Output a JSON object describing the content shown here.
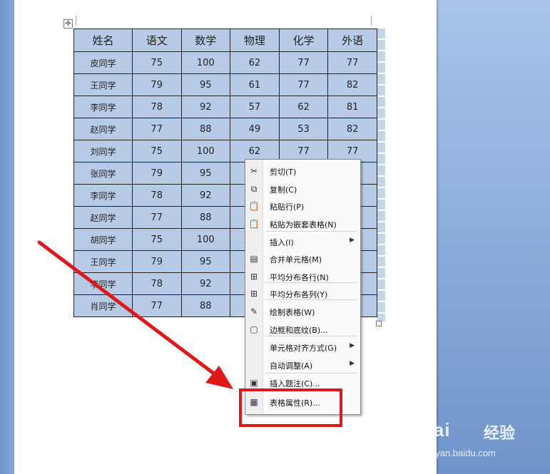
{
  "table": {
    "headers": [
      "姓名",
      "语文",
      "数学",
      "物理",
      "化学",
      "外语"
    ],
    "rows": [
      [
        "皮同学",
        "75",
        "100",
        "62",
        "77",
        "77"
      ],
      [
        "王同学",
        "79",
        "95",
        "61",
        "77",
        "82"
      ],
      [
        "李同学",
        "78",
        "92",
        "57",
        "62",
        "81"
      ],
      [
        "赵同学",
        "77",
        "88",
        "49",
        "53",
        "82"
      ],
      [
        "刘同学",
        "75",
        "100",
        "62",
        "77",
        "77"
      ],
      [
        "张同学",
        "79",
        "95",
        "",
        "",
        ""
      ],
      [
        "李同学",
        "78",
        "92",
        "",
        "",
        ""
      ],
      [
        "赵同学",
        "77",
        "88",
        "",
        "",
        ""
      ],
      [
        "胡同学",
        "75",
        "100",
        "",
        "",
        ""
      ],
      [
        "王同学",
        "79",
        "95",
        "",
        "",
        ""
      ],
      [
        "李同学",
        "78",
        "92",
        "",
        "",
        ""
      ],
      [
        "肖同学",
        "77",
        "88",
        "",
        "",
        ""
      ]
    ]
  },
  "context_menu": {
    "items": [
      {
        "label": "剪切(T)",
        "icon": "scissors-icon",
        "glyph": "✂"
      },
      {
        "label": "复制(C)",
        "icon": "copy-icon",
        "glyph": "⧉"
      },
      {
        "label": "粘贴行(P)",
        "icon": "paste-icon",
        "glyph": "📋"
      },
      {
        "label": "粘贴为嵌套表格(N)",
        "icon": "paste-nested-icon",
        "glyph": "📋"
      },
      {
        "label": "插入(I)",
        "icon": "",
        "glyph": ""
      },
      {
        "label": "合并单元格(M)",
        "icon": "merge-cells-icon",
        "glyph": "▤"
      },
      {
        "label": "平均分布各行(N)",
        "icon": "distribute-rows-icon",
        "glyph": "⊞"
      },
      {
        "label": "平均分布各列(Y)",
        "icon": "distribute-columns-icon",
        "glyph": "⊞"
      },
      {
        "label": "绘制表格(W)",
        "icon": "draw-table-icon",
        "glyph": "✎"
      },
      {
        "label": "边框和底纹(B)...",
        "icon": "borders-shading-icon",
        "glyph": "▢"
      },
      {
        "label": "单元格对齐方式(G)",
        "icon": "",
        "glyph": ""
      },
      {
        "label": "自动调整(A)",
        "icon": "",
        "glyph": ""
      },
      {
        "label": "插入题注(C)...",
        "icon": "insert-caption-icon",
        "glyph": "▣"
      },
      {
        "label": "表格属性(R)...",
        "icon": "table-properties-icon",
        "glyph": "▦"
      }
    ]
  },
  "watermark": {
    "brand": "Bai",
    "brand2": "经验",
    "url": "jingyan.baidu.com"
  },
  "colors": {
    "cell_fill": "#b8cbe6",
    "highlight": "#e01818",
    "arrow": "#e01818"
  }
}
